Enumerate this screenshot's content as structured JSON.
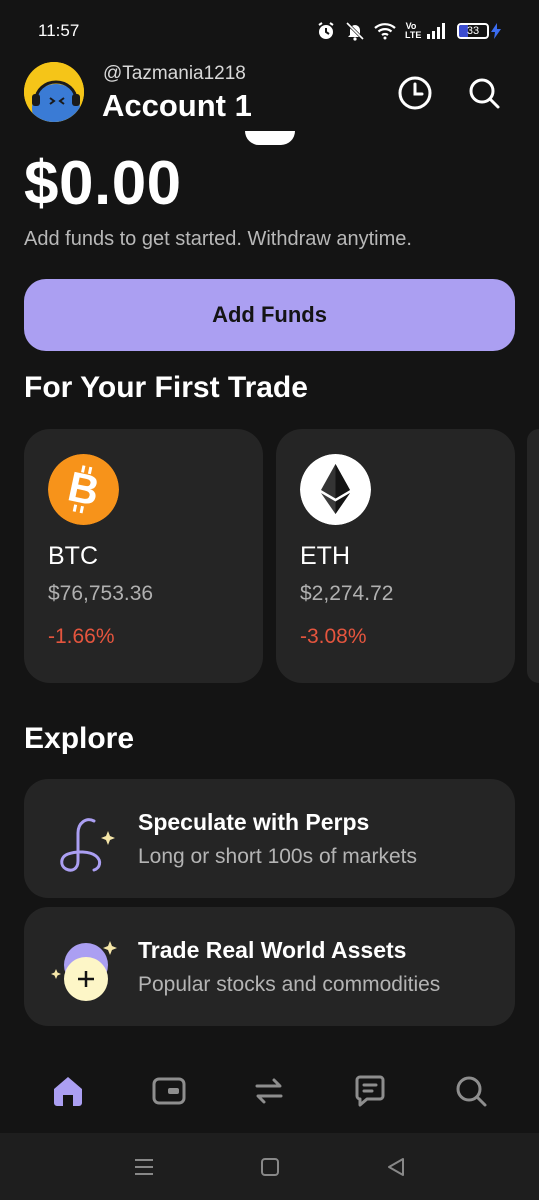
{
  "status_bar": {
    "time": "11:57",
    "battery": "33",
    "volte": "Vo LTE"
  },
  "header": {
    "handle": "@Tazmania1218",
    "account_name": "Account 1"
  },
  "balance": {
    "amount": "$0.00",
    "subtitle": "Add funds to get started. Withdraw anytime."
  },
  "add_funds": {
    "label": "Add Funds"
  },
  "first_trade": {
    "title": "For Your First Trade",
    "items": [
      {
        "symbol": "BTC",
        "price": "$76,753.36",
        "change": "-1.66%",
        "icon": "bitcoin-icon",
        "color": "#f7931a"
      },
      {
        "symbol": "ETH",
        "price": "$2,274.72",
        "change": "-3.08%",
        "icon": "ethereum-icon",
        "color": "#ffffff"
      }
    ]
  },
  "explore": {
    "title": "Explore",
    "items": [
      {
        "title": "Speculate with Perps",
        "subtitle": "Long or short 100s of markets",
        "icon": "perps-icon"
      },
      {
        "title": "Trade Real World Assets",
        "subtitle": "Popular stocks and commodities",
        "icon": "rwa-icon"
      }
    ]
  },
  "bottom_nav": {
    "items": [
      "home-icon",
      "wallet-icon",
      "swap-icon",
      "chat-icon",
      "search-icon"
    ],
    "active": "home-icon"
  },
  "colors": {
    "background": "#141414",
    "card": "#252525",
    "accent": "#ab9ff2",
    "negative": "#e5553e"
  }
}
